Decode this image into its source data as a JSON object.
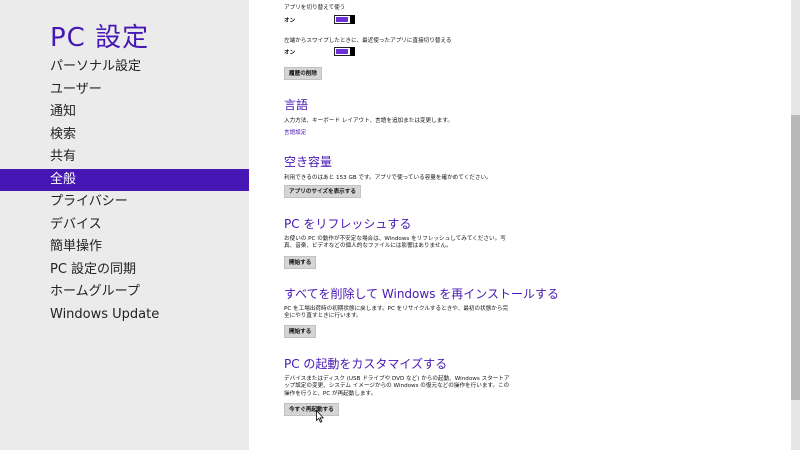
{
  "sidebar": {
    "title": "PC 設定",
    "items": [
      {
        "label": "パーソナル設定"
      },
      {
        "label": "ユーザー"
      },
      {
        "label": "通知"
      },
      {
        "label": "検索"
      },
      {
        "label": "共有"
      },
      {
        "label": "全般",
        "selected": true
      },
      {
        "label": "プライバシー"
      },
      {
        "label": "デバイス"
      },
      {
        "label": "簡単操作"
      },
      {
        "label": "PC 設定の同期"
      },
      {
        "label": "ホームグループ"
      },
      {
        "label": "Windows Update"
      }
    ]
  },
  "app_switching": {
    "toggle1_label": "アプリを切り替えて使う",
    "toggle1_state": "オン",
    "toggle2_label": "左端からスワイプしたときに、最近使ったアプリに直接切り替える",
    "toggle2_state": "オン",
    "clear_history_button": "履歴の削除"
  },
  "language": {
    "title": "言語",
    "description": "入力方法、キーボード レイアウト、言語を追加または変更します。",
    "link": "言語設定"
  },
  "storage": {
    "title": "空き容量",
    "description": "利用できるのはあと 153 GB です。アプリで使っている容量を確かめてください。",
    "button": "アプリのサイズを表示する"
  },
  "refresh": {
    "title": "PC をリフレッシュする",
    "description": "お使いの PC の動作が不安定な場合は、Windows をリフレッシュしてみてください。写真、音楽、ビデオなどの個人的なファイルには影響はありません。",
    "button": "開始する"
  },
  "reinstall": {
    "title": "すべてを削除して Windows を再インストールする",
    "description": "PC を工場出荷時の初期状態に戻します。PC をリサイクルするときや、最初の状態から完全にやり直すときに行います。",
    "button": "開始する"
  },
  "startup": {
    "title": "PC の起動をカスタマイズする",
    "description": "デバイスまたはディスク (USB ドライブや DVD など) からの起動、Windows スタートアップ設定の変更、システム イメージからの Windows の復元などの操作を行います。この操作を行うと、PC が再起動します。",
    "button": "今すぐ再起動する"
  },
  "colors": {
    "accent": "#4617b4",
    "toggle_fill": "#6e2ed8",
    "sidebar_bg": "#ebebeb"
  }
}
